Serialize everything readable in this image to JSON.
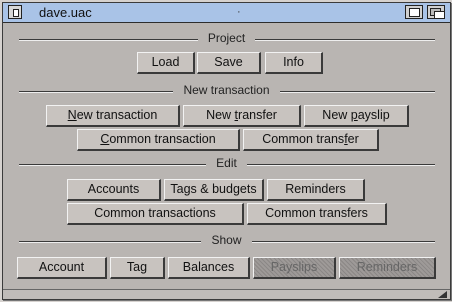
{
  "window": {
    "title": "dave.uac"
  },
  "groups": {
    "project": {
      "label": "Project",
      "buttons": {
        "load": "Load",
        "save": "Save",
        "info": "Info"
      }
    },
    "new_transaction": {
      "label": "New transaction",
      "buttons": {
        "new_transaction_pre": "",
        "new_transaction_u": "N",
        "new_transaction_post": "ew transaction",
        "new_transfer_pre": "New ",
        "new_transfer_u": "t",
        "new_transfer_post": "ransfer",
        "new_payslip_pre": "New ",
        "new_payslip_u": "p",
        "new_payslip_post": "ayslip",
        "common_transaction_pre": "",
        "common_transaction_u": "C",
        "common_transaction_post": "ommon transaction",
        "common_transfer_pre": "Common trans",
        "common_transfer_u": "f",
        "common_transfer_post": "er"
      }
    },
    "edit": {
      "label": "Edit",
      "buttons": {
        "accounts": "Accounts",
        "tags_budgets": "Tags & budgets",
        "reminders": "Reminders",
        "common_transactions": "Common transactions",
        "common_transfers": "Common transfers"
      }
    },
    "show": {
      "label": "Show",
      "buttons": {
        "account": "Account",
        "tag": "Tag",
        "balances": "Balances",
        "payslips": "Payslips",
        "reminders": "Reminders"
      }
    }
  }
}
